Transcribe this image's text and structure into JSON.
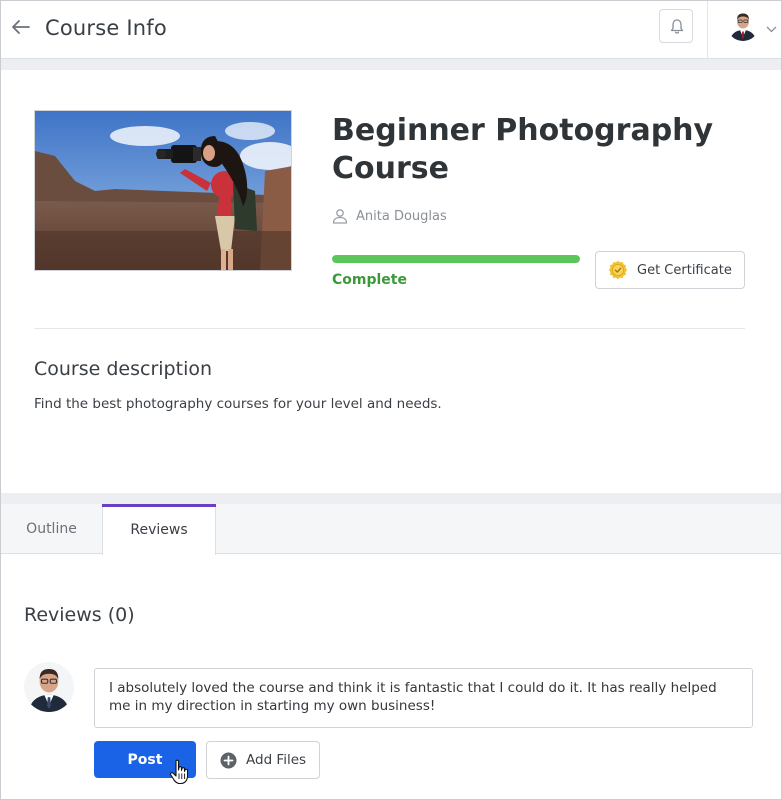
{
  "header": {
    "title": "Course Info",
    "icons": {
      "back": "arrow-left-icon",
      "notifications": "bell-icon",
      "menu": "chevron-down-icon"
    }
  },
  "course": {
    "title": "Beginner Photography Course",
    "instructor": "Anita Douglas",
    "progress_percent": 100,
    "status": "Complete",
    "certificate_button": "Get Certificate",
    "description_title": "Course description",
    "description": "Find the best photography courses for your level and needs."
  },
  "tabs": [
    {
      "label": "Outline",
      "active": false
    },
    {
      "label": "Reviews",
      "active": true
    }
  ],
  "reviews": {
    "title": "Reviews (0)",
    "draft_text": "I absolutely loved the course and think it is fantastic that I could do it. It has really helped me in my direction in starting my own business!",
    "post_button": "Post",
    "add_files_button": "Add Files"
  },
  "colors": {
    "accent_blue": "#1a63e6",
    "progress_green": "#5cc55c",
    "status_green": "#3a9a3a",
    "tab_indicator": "#6a3fc6"
  }
}
